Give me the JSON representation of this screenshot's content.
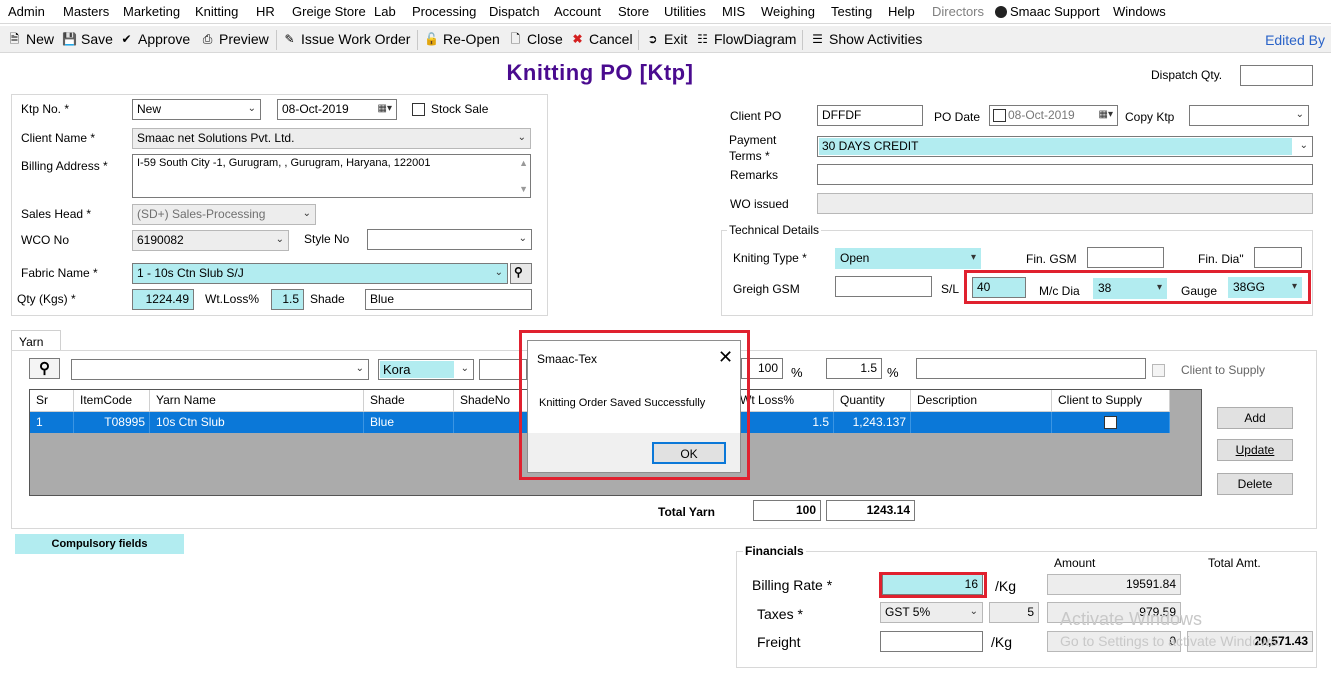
{
  "menu": [
    "Admin",
    "Masters",
    "Marketing",
    "Knitting",
    "HR",
    "Greige Store",
    "Lab",
    "Processing",
    "Dispatch",
    "Account",
    "Store",
    "Utilities",
    "MIS",
    "Weighing",
    "Testing",
    "Help",
    "Directors",
    "Smaac Support",
    "Windows"
  ],
  "toolbar": {
    "new": "New",
    "save": "Save",
    "approve": "Approve",
    "preview": "Preview",
    "issue_work_order": "Issue Work Order",
    "reopen": "Re-Open",
    "close": "Close",
    "cancel": "Cancel",
    "exit": "Exit",
    "flow": "FlowDiagram",
    "show_activities": "Show Activities",
    "edited_by": "Edited By"
  },
  "page": {
    "title": "Knitting PO [Ktp]",
    "dispatch_qty_label": "Dispatch Qty.",
    "dispatch_qty": ""
  },
  "left": {
    "ktp_no_label": "Ktp No. *",
    "ktp_no": "New",
    "date": "08-Oct-2019",
    "stock_sale_label": "Stock Sale",
    "client_name_label": "Client Name *",
    "client_name": "Smaac net Solutions Pvt. Ltd.",
    "billing_address_label": "Billing Address *",
    "billing_address": "I-59 South City -1, Gurugram, , Gurugram, Haryana, 122001",
    "sales_head_label": "Sales Head *",
    "sales_head": "(SD+) Sales-Processing",
    "wco_no_label": "WCO No",
    "wco_no": "6190082",
    "style_no_label": "Style No",
    "style_no": "",
    "fabric_name_label": "Fabric Name *",
    "fabric_name": "1 - 10s Ctn Slub S/J",
    "qty_label": "Qty (Kgs) *",
    "qty": "1224.49",
    "wt_loss_label": "Wt.Loss%",
    "wt_loss": "1.5",
    "shade_label": "Shade",
    "shade": "Blue"
  },
  "right": {
    "client_po_label": "Client PO",
    "client_po": "DFFDF",
    "po_date_label": "PO Date",
    "po_date": "08-Oct-2019",
    "copy_ktp_label": "Copy Ktp",
    "copy_ktp": "",
    "payment_terms_label_1": "Payment",
    "payment_terms_label_2": "Terms *",
    "payment_terms": "30 DAYS CREDIT",
    "remarks_label": "Remarks",
    "remarks": "",
    "wo_issued_label": "WO issued",
    "wo_issued": ""
  },
  "technical": {
    "title": "Technical Details",
    "knitting_type_label": "Kniting Type *",
    "knitting_type": "Open",
    "fin_gsm_label": "Fin. GSM",
    "fin_gsm": "",
    "fin_dia_label": "Fin. Dia\"",
    "fin_dia": "",
    "greigh_gsm_label": "Greigh GSM",
    "greigh_gsm": "",
    "sl_label": "S/L",
    "sl": "40",
    "mc_dia_label": "M/c Dia",
    "mc_dia": "38",
    "gauge_label": "Gauge",
    "gauge": "38GG"
  },
  "yarn": {
    "tab_label": "Yarn",
    "search": "",
    "kora": "Kora",
    "ratio": "100",
    "pct1": "%",
    "wt": "1.5",
    "pct2": "%",
    "desc": "",
    "client_supply_label": "Client to Supply",
    "columns": [
      "Sr",
      "ItemCode",
      "Yarn Name",
      "Shade",
      "ShadeNo",
      "Wt Loss%",
      "Quantity",
      "Description",
      "Client to Supply"
    ],
    "rows": [
      {
        "sr": "1",
        "item_code": "T08995",
        "yarn_name": "10s Ctn Slub",
        "shade": "Blue",
        "shade_no": "",
        "wt_loss": "1.5",
        "quantity": "1,243.137",
        "description": ""
      }
    ],
    "add": "Add",
    "update": "Update",
    "delete": "Delete",
    "total_label": "Total Yarn",
    "total_ratio": "100",
    "total_qty": "1243.14"
  },
  "compulsory": "Compulsory fields",
  "financials": {
    "title": "Financials",
    "amount_header": "Amount",
    "total_header": "Total Amt.",
    "billing_rate_label": "Billing Rate *",
    "billing_rate": "16",
    "per_kg": "/Kg",
    "billing_amount": "19591.84",
    "taxes_label": "Taxes *",
    "taxes": "GST 5%",
    "tax_pct": "5",
    "tax_amount": "979.59",
    "freight_label": "Freight",
    "freight": "",
    "per_kg2": "/Kg",
    "freight_amount": "0",
    "total_amount": "20,571.43"
  },
  "dialog": {
    "title": "Smaac-Tex",
    "message": "Knitting Order Saved Successfully",
    "ok": "OK"
  },
  "watermark": {
    "line1": "Activate Windows",
    "line2": "Go to Settings to activate Windows."
  }
}
